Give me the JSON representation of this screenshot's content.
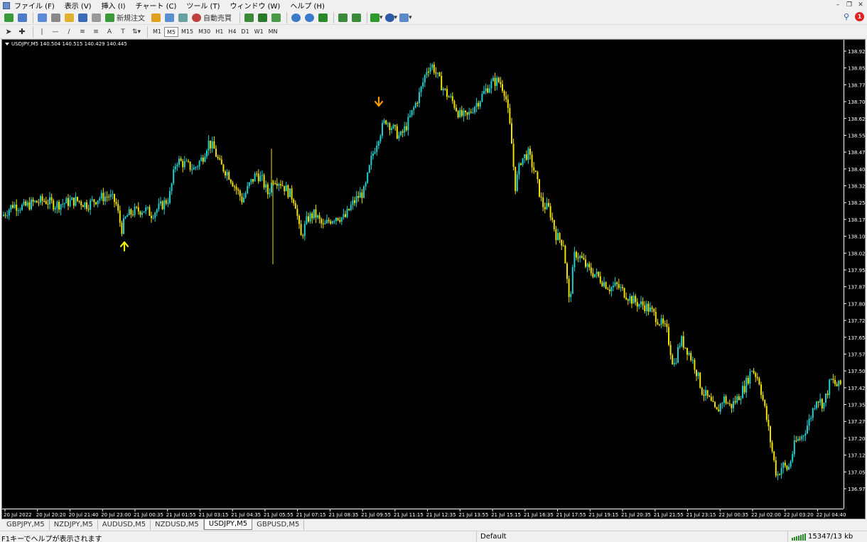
{
  "menu": {
    "items": [
      "ファイル (F)",
      "表示 (V)",
      "挿入 (I)",
      "チャート (C)",
      "ツール (T)",
      "ウィンドウ (W)",
      "ヘルプ (H)"
    ]
  },
  "toolbar": {
    "new_order_label": "新規注文",
    "auto_trading_label": "自動売買",
    "timeframes": [
      "M1",
      "M5",
      "M15",
      "M30",
      "H1",
      "H4",
      "D1",
      "W1",
      "MN"
    ],
    "active_timeframe": "M5",
    "notification_count": "1"
  },
  "chart": {
    "header_text": "USDJPY,M5  140.504 140.515 140.429 140.445",
    "colors": {
      "background": "#000000",
      "bull": "#1fd0d0",
      "bear": "#f0e000",
      "text": "#ffffff",
      "axis": "#ffffff"
    },
    "arrows": [
      {
        "type": "up",
        "color": "#f0f000"
      },
      {
        "type": "down",
        "color": "#ff9900"
      }
    ]
  },
  "chart_data": {
    "type": "candlestick",
    "symbol": "USDJPY",
    "timeframe": "M5",
    "ylim": [
      136.975,
      138.925
    ],
    "y_ticks": [
      "138.925",
      "138.850",
      "138.775",
      "138.700",
      "138.625",
      "138.550",
      "138.475",
      "138.400",
      "138.325",
      "138.250",
      "138.175",
      "138.100",
      "138.025",
      "137.950",
      "137.875",
      "137.800",
      "137.725",
      "137.650",
      "137.575",
      "137.500",
      "137.425",
      "137.350",
      "137.275",
      "137.200",
      "137.125",
      "137.050",
      "136.975"
    ],
    "x_ticks": [
      "20 Jul 2022",
      "20 Jul 20:20",
      "20 Jul 21:40",
      "20 Jul 23:00",
      "21 Jul 00:35",
      "21 Jul 01:55",
      "21 Jul 03:15",
      "21 Jul 04:35",
      "21 Jul 05:55",
      "21 Jul 07:15",
      "21 Jul 08:35",
      "21 Jul 09:55",
      "21 Jul 11:15",
      "21 Jul 12:35",
      "21 Jul 13:55",
      "21 Jul 15:15",
      "21 Jul 16:35",
      "21 Jul 17:55",
      "21 Jul 19:15",
      "21 Jul 20:35",
      "21 Jul 21:55",
      "21 Jul 23:15",
      "22 Jul 00:35",
      "22 Jul 02:00",
      "22 Jul 03:20",
      "22 Jul 04:40"
    ],
    "close_path": [
      [
        0,
        138.19
      ],
      [
        15,
        138.24
      ],
      [
        30,
        138.23
      ],
      [
        45,
        138.25
      ],
      [
        60,
        138.26
      ],
      [
        75,
        138.24
      ],
      [
        90,
        138.25
      ],
      [
        105,
        138.26
      ],
      [
        120,
        138.24
      ],
      [
        135,
        138.27
      ],
      [
        150,
        138.28
      ],
      [
        160,
        138.25
      ],
      [
        168,
        138.13
      ],
      [
        175,
        138.19
      ],
      [
        185,
        138.21
      ],
      [
        200,
        138.22
      ],
      [
        210,
        138.2
      ],
      [
        222,
        138.23
      ],
      [
        235,
        138.27
      ],
      [
        245,
        138.44
      ],
      [
        258,
        138.42
      ],
      [
        270,
        138.4
      ],
      [
        282,
        138.45
      ],
      [
        290,
        138.52
      ],
      [
        298,
        138.49
      ],
      [
        306,
        138.42
      ],
      [
        318,
        138.38
      ],
      [
        328,
        138.32
      ],
      [
        338,
        138.26
      ],
      [
        348,
        138.33
      ],
      [
        358,
        138.38
      ],
      [
        366,
        138.35
      ],
      [
        374,
        138.29
      ],
      [
        382,
        138.36
      ],
      [
        392,
        138.34
      ],
      [
        402,
        138.3
      ],
      [
        412,
        138.26
      ],
      [
        420,
        138.09
      ],
      [
        430,
        138.18
      ],
      [
        440,
        138.2
      ],
      [
        452,
        138.14
      ],
      [
        460,
        138.17
      ],
      [
        470,
        138.19
      ],
      [
        482,
        138.18
      ],
      [
        492,
        138.24
      ],
      [
        502,
        138.28
      ],
      [
        510,
        138.3
      ],
      [
        520,
        138.45
      ],
      [
        530,
        138.55
      ],
      [
        540,
        138.62
      ],
      [
        550,
        138.58
      ],
      [
        560,
        138.54
      ],
      [
        570,
        138.6
      ],
      [
        578,
        138.66
      ],
      [
        588,
        138.74
      ],
      [
        598,
        138.85
      ],
      [
        606,
        138.86
      ],
      [
        614,
        138.8
      ],
      [
        624,
        138.74
      ],
      [
        634,
        138.7
      ],
      [
        644,
        138.64
      ],
      [
        654,
        138.63
      ],
      [
        664,
        138.68
      ],
      [
        672,
        138.71
      ],
      [
        682,
        138.76
      ],
      [
        692,
        138.79
      ],
      [
        700,
        138.79
      ],
      [
        708,
        138.74
      ],
      [
        716,
        138.55
      ],
      [
        722,
        138.32
      ],
      [
        730,
        138.44
      ],
      [
        740,
        138.47
      ],
      [
        750,
        138.38
      ],
      [
        760,
        138.24
      ],
      [
        770,
        138.22
      ],
      [
        780,
        138.1
      ],
      [
        790,
        138.07
      ],
      [
        798,
        137.8
      ],
      [
        806,
        138.03
      ],
      [
        815,
        138.0
      ],
      [
        825,
        137.95
      ],
      [
        835,
        137.93
      ],
      [
        845,
        137.9
      ],
      [
        855,
        137.87
      ],
      [
        865,
        137.88
      ],
      [
        875,
        137.85
      ],
      [
        885,
        137.82
      ],
      [
        895,
        137.8
      ],
      [
        905,
        137.79
      ],
      [
        915,
        137.76
      ],
      [
        925,
        137.72
      ],
      [
        935,
        137.68
      ],
      [
        945,
        137.52
      ],
      [
        955,
        137.64
      ],
      [
        965,
        137.59
      ],
      [
        975,
        137.52
      ],
      [
        985,
        137.41
      ],
      [
        995,
        137.37
      ],
      [
        1005,
        137.31
      ],
      [
        1015,
        137.38
      ],
      [
        1025,
        137.34
      ],
      [
        1035,
        137.38
      ],
      [
        1045,
        137.43
      ],
      [
        1055,
        137.51
      ],
      [
        1065,
        137.46
      ],
      [
        1075,
        137.3
      ],
      [
        1082,
        137.17
      ],
      [
        1090,
        137.03
      ],
      [
        1098,
        137.08
      ],
      [
        1106,
        137.06
      ],
      [
        1116,
        137.18
      ],
      [
        1126,
        137.21
      ],
      [
        1136,
        137.28
      ],
      [
        1146,
        137.38
      ],
      [
        1156,
        137.35
      ],
      [
        1166,
        137.46
      ],
      [
        1176,
        137.43
      ],
      [
        1184,
        137.45
      ]
    ],
    "spikes": [
      {
        "x": 381,
        "low": 137.975
      },
      {
        "x": 379,
        "high": 138.49
      }
    ],
    "signals": [
      {
        "type": "buy-arrow",
        "x": 172,
        "price": 138.055
      },
      {
        "type": "sell-arrow",
        "x": 530,
        "price": 138.7
      }
    ]
  },
  "tabs": [
    "GBPJPY,M5",
    "NZDJPY,M5",
    "AUDUSD,M5",
    "NZDUSD,M5",
    "USDJPY,M5",
    "GBPUSD,M5"
  ],
  "active_tab": "USDJPY,M5",
  "status": {
    "help_text": "F1キーでヘルプが表示されます",
    "profile": "Default",
    "connection": "15347/13 kb"
  }
}
